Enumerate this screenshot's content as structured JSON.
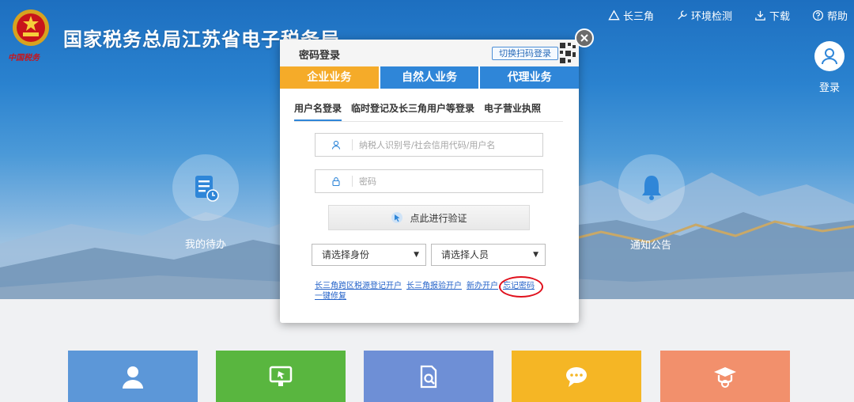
{
  "header": {
    "site_title": "国家税务总局江苏省电子税务局",
    "emblem_caption": "中国税务"
  },
  "top_nav": [
    {
      "label": "长三角",
      "icon": "triangle-icon"
    },
    {
      "label": "环境检测",
      "icon": "wrench-icon"
    },
    {
      "label": "下载",
      "icon": "download-icon"
    },
    {
      "label": "帮助",
      "icon": "help-icon"
    }
  ],
  "user": {
    "login_label": "登录"
  },
  "shortcuts": {
    "todo_label": "我的待办",
    "notice_label": "通知公告"
  },
  "dialog": {
    "title": "密码登录",
    "switch_qr_label": "切换扫码登录",
    "biz_tabs": [
      "企业业务",
      "自然人业务",
      "代理业务"
    ],
    "login_tabs": [
      "用户名登录",
      "临时登记及长三角用户等登录",
      "电子营业执照"
    ],
    "username_placeholder": "纳税人识别号/社会信用代码/用户名",
    "password_placeholder": "密码",
    "verify_label": "点此进行验证",
    "identity_select": "请选择身份",
    "person_select": "请选择人员",
    "links": [
      "长三角跨区税源登记开户",
      "长三角报验开户",
      "新办开户",
      "忘记密码",
      "一键修复"
    ]
  },
  "colors": {
    "primary_blue": "#2f86d8",
    "active_orange": "#f5ab29",
    "highlight_red": "#e0101c",
    "link_blue": "#2563c9"
  }
}
